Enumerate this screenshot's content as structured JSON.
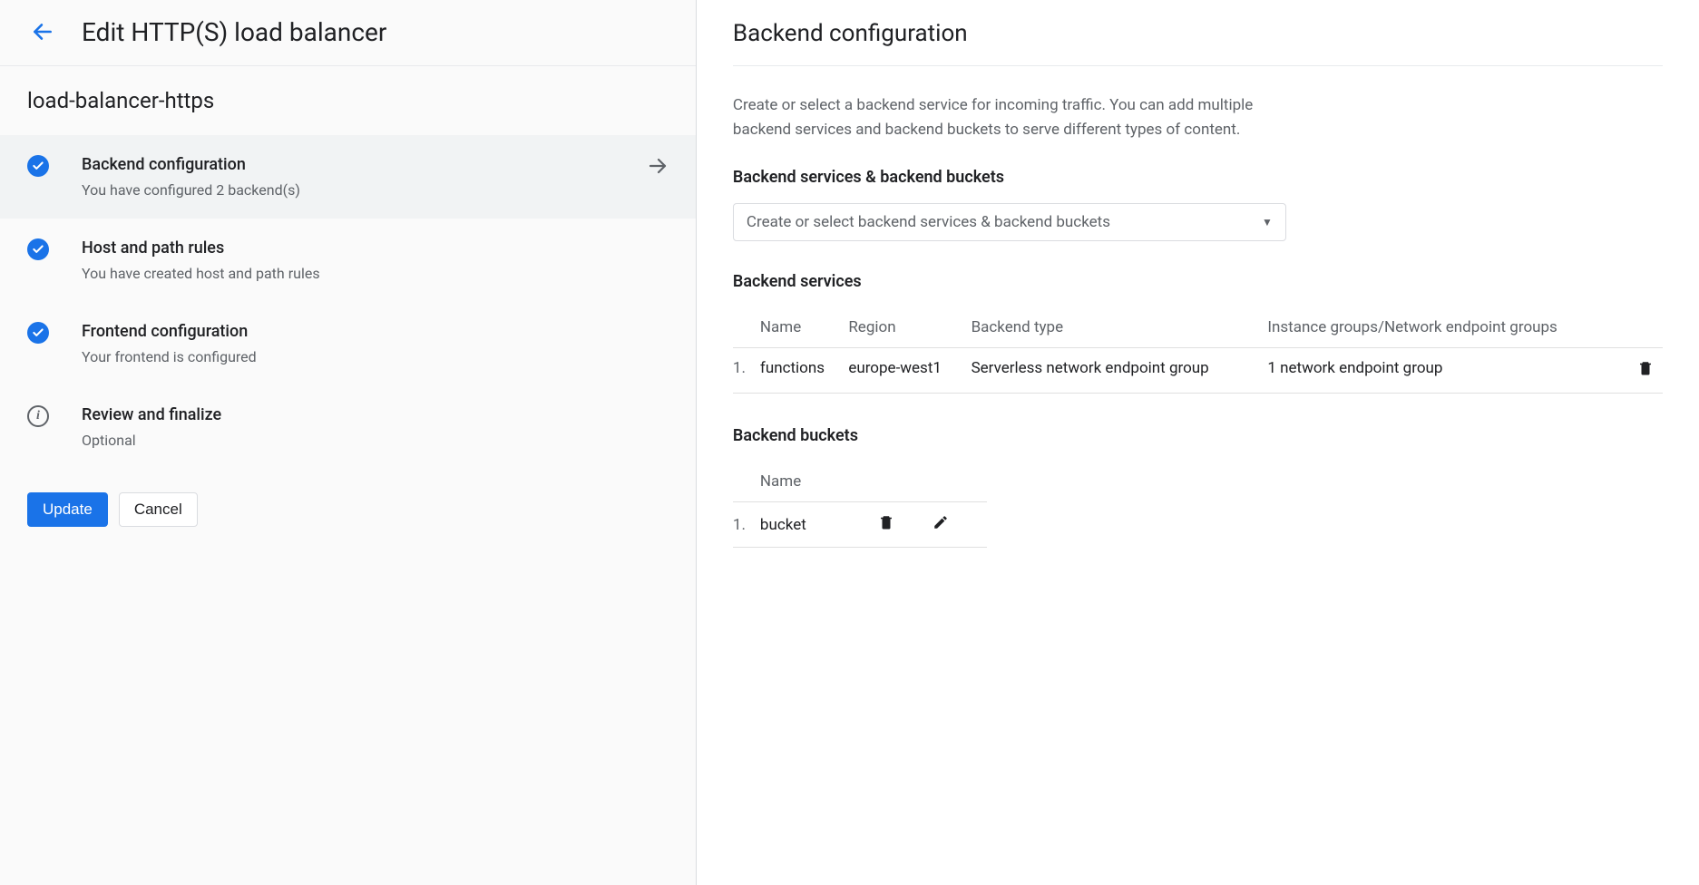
{
  "left": {
    "title": "Edit HTTP(S) load balancer",
    "lb_name": "load-balancer-https",
    "steps": [
      {
        "title": "Backend configuration",
        "sub": "You have configured 2 backend(s)",
        "icon": "check",
        "active": true,
        "chevron": true
      },
      {
        "title": "Host and path rules",
        "sub": "You have created host and path rules",
        "icon": "check",
        "active": false,
        "chevron": false
      },
      {
        "title": "Frontend configuration",
        "sub": "Your frontend is configured",
        "icon": "check",
        "active": false,
        "chevron": false
      },
      {
        "title": "Review and finalize",
        "sub": "Optional",
        "icon": "info",
        "active": false,
        "chevron": false
      }
    ],
    "buttons": {
      "update": "Update",
      "cancel": "Cancel"
    }
  },
  "right": {
    "title": "Backend configuration",
    "desc": "Create or select a backend service for incoming traffic. You can add multiple backend services and backend buckets to serve different types of content.",
    "section_h": "Backend services & backend buckets",
    "dropdown_placeholder": "Create or select backend services & backend buckets",
    "services": {
      "heading": "Backend services",
      "columns": [
        "Name",
        "Region",
        "Backend type",
        "Instance groups/Network endpoint groups"
      ],
      "rows": [
        {
          "idx": "1.",
          "name": "functions",
          "region": "europe-west1",
          "type": "Serverless network endpoint group",
          "groups": "1 network endpoint group"
        }
      ]
    },
    "buckets": {
      "heading": "Backend buckets",
      "columns": [
        "Name"
      ],
      "rows": [
        {
          "idx": "1.",
          "name": "bucket"
        }
      ]
    }
  }
}
